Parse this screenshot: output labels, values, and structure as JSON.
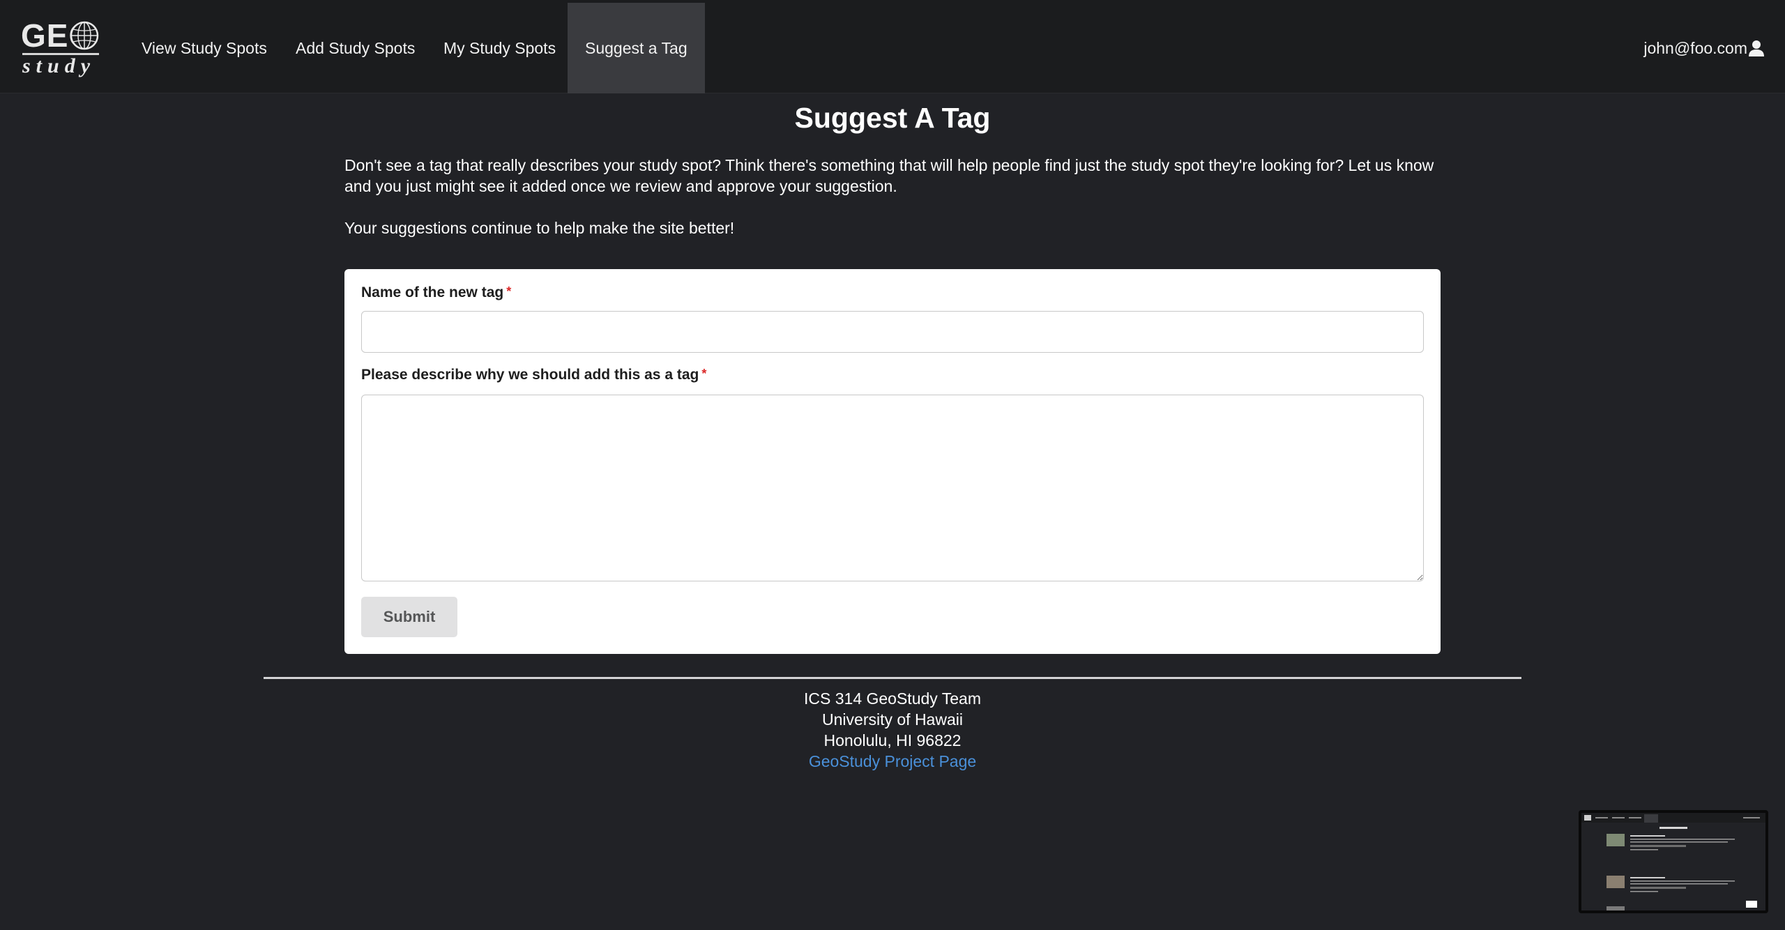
{
  "brand": {
    "logo_text_top": "GEO",
    "logo_text_bottom": "study"
  },
  "nav": {
    "items": [
      {
        "label": "View Study Spots",
        "active": false
      },
      {
        "label": "Add Study Spots",
        "active": false
      },
      {
        "label": "My Study Spots",
        "active": false
      },
      {
        "label": "Suggest a Tag",
        "active": true
      }
    ],
    "user_email": "john@foo.com"
  },
  "page": {
    "title": "Suggest A Tag",
    "intro_paragraph": "Don't see a tag that really describes your study spot? Think there's something that will help people find just the study spot they're looking for? Let us know and you just might see it added once we review and approve your suggestion.",
    "intro_secondary": "Your suggestions continue to help make the site better!"
  },
  "form": {
    "name_label": "Name of the new tag",
    "name_value": "",
    "description_label": "Please describe why we should add this as a tag",
    "description_value": "",
    "required_marker": "*",
    "submit_label": "Submit"
  },
  "footer": {
    "line1": "ICS 314 GeoStudy Team",
    "line2": "University of Hawaii",
    "line3": "Honolulu, HI 96822",
    "link_label": "GeoStudy Project Page"
  },
  "colors": {
    "page_background": "#212226",
    "navbar_background": "#1b1c1e",
    "active_nav_background": "#3a3b3f",
    "required_marker": "#db2828",
    "link": "#4a90d9"
  },
  "icons": {
    "user": "user-icon",
    "globe": "globe-icon"
  }
}
